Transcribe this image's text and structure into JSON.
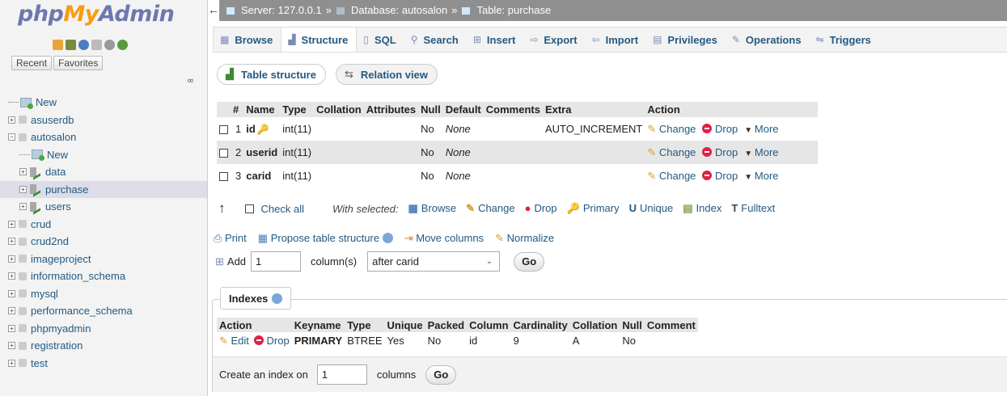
{
  "sidebar": {
    "logo_php": "php",
    "logo_my": "My",
    "logo_admin": "Admin",
    "recent": "Recent",
    "favorites": "Favorites",
    "tree": [
      {
        "label": "New",
        "kind": "new",
        "level": 0
      },
      {
        "label": "asuserdb",
        "kind": "db",
        "level": 0
      },
      {
        "label": "autosalon",
        "kind": "db-open",
        "level": 0
      },
      {
        "label": "New",
        "kind": "new",
        "level": 1
      },
      {
        "label": "data",
        "kind": "table",
        "level": 1
      },
      {
        "label": "purchase",
        "kind": "table",
        "level": 1,
        "selected": true
      },
      {
        "label": "users",
        "kind": "table",
        "level": 1
      },
      {
        "label": "crud",
        "kind": "db",
        "level": 0
      },
      {
        "label": "crud2nd",
        "kind": "db",
        "level": 0
      },
      {
        "label": "imageproject",
        "kind": "db",
        "level": 0
      },
      {
        "label": "information_schema",
        "kind": "db",
        "level": 0
      },
      {
        "label": "mysql",
        "kind": "db",
        "level": 0
      },
      {
        "label": "performance_schema",
        "kind": "db",
        "level": 0
      },
      {
        "label": "phpmyadmin",
        "kind": "db",
        "level": 0
      },
      {
        "label": "registration",
        "kind": "db",
        "level": 0
      },
      {
        "label": "test",
        "kind": "db",
        "level": 0
      }
    ]
  },
  "breadcrumb": {
    "server": "Server: 127.0.0.1",
    "database": "Database: autosalon",
    "table": "Table: purchase",
    "sep": "»"
  },
  "tabs": [
    {
      "label": "Browse",
      "icon": "browse-icon"
    },
    {
      "label": "Structure",
      "icon": "structure-icon",
      "active": true
    },
    {
      "label": "SQL",
      "icon": "sql-icon"
    },
    {
      "label": "Search",
      "icon": "search-icon"
    },
    {
      "label": "Insert",
      "icon": "insert-icon"
    },
    {
      "label": "Export",
      "icon": "export-icon"
    },
    {
      "label": "Import",
      "icon": "import-icon"
    },
    {
      "label": "Privileges",
      "icon": "privileges-icon"
    },
    {
      "label": "Operations",
      "icon": "operations-icon"
    },
    {
      "label": "Triggers",
      "icon": "triggers-icon"
    }
  ],
  "subtabs": {
    "table_structure": "Table structure",
    "relation_view": "Relation view"
  },
  "structure": {
    "headers": [
      "#",
      "Name",
      "Type",
      "Collation",
      "Attributes",
      "Null",
      "Default",
      "Comments",
      "Extra",
      "Action"
    ],
    "rows": [
      {
        "num": "1",
        "name": "id",
        "type": "int(11)",
        "collation": "",
        "attributes": "",
        "null": "No",
        "default": "None",
        "comments": "",
        "extra": "AUTO_INCREMENT",
        "primary": true
      },
      {
        "num": "2",
        "name": "userid",
        "type": "int(11)",
        "collation": "",
        "attributes": "",
        "null": "No",
        "default": "None",
        "comments": "",
        "extra": ""
      },
      {
        "num": "3",
        "name": "carid",
        "type": "int(11)",
        "collation": "",
        "attributes": "",
        "null": "No",
        "default": "None",
        "comments": "",
        "extra": ""
      }
    ],
    "actions": {
      "change": "Change",
      "drop": "Drop",
      "more": "More"
    }
  },
  "checkall": {
    "label": "Check all",
    "with_selected": "With selected:",
    "items": [
      "Browse",
      "Change",
      "Drop",
      "Primary",
      "Unique",
      "Index",
      "Fulltext"
    ]
  },
  "tools": {
    "print": "Print",
    "propose": "Propose table structure",
    "move": "Move columns",
    "normalize": "Normalize"
  },
  "add_column": {
    "label": "Add",
    "count": "1",
    "unit": "column(s)",
    "position": "after carid",
    "go": "Go"
  },
  "indexes": {
    "legend": "Indexes",
    "headers": [
      "Action",
      "Keyname",
      "Type",
      "Unique",
      "Packed",
      "Column",
      "Cardinality",
      "Collation",
      "Null",
      "Comment"
    ],
    "rows": [
      {
        "edit": "Edit",
        "drop": "Drop",
        "keyname": "PRIMARY",
        "type": "BTREE",
        "unique": "Yes",
        "packed": "No",
        "column": "id",
        "cardinality": "9",
        "collation": "A",
        "null": "No",
        "comment": ""
      }
    ],
    "create_label": "Create an index on",
    "create_count": "1",
    "create_unit": "columns",
    "go": "Go"
  }
}
